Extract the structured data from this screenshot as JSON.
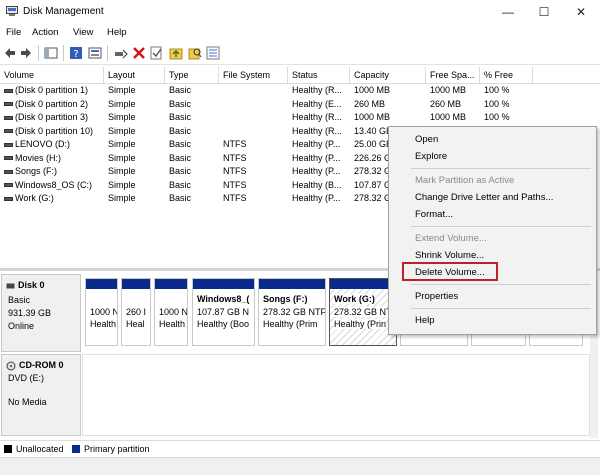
{
  "window": {
    "title": "Disk Management",
    "minimize_glyph": "—",
    "maximize_glyph": "☐",
    "close_glyph": "✕"
  },
  "menu": [
    "File",
    "Action",
    "View",
    "Help"
  ],
  "toolbar_icons": [
    "back-icon",
    "forward-icon",
    "console-tree-icon",
    "help-icon",
    "properties-icon",
    "connect-icon",
    "delete-icon",
    "check-icon",
    "folder-up-icon",
    "search-icon",
    "list-icon"
  ],
  "columns": [
    "Volume",
    "Layout",
    "Type",
    "File System",
    "Status",
    "Capacity",
    "Free Spa...",
    "% Free"
  ],
  "volumes": [
    {
      "volume": "(Disk 0 partition 1)",
      "layout": "Simple",
      "type": "Basic",
      "fs": "",
      "status": "Healthy (R...",
      "capacity": "1000 MB",
      "free": "1000 MB",
      "pct": "100 %"
    },
    {
      "volume": "(Disk 0 partition 2)",
      "layout": "Simple",
      "type": "Basic",
      "fs": "",
      "status": "Healthy (E...",
      "capacity": "260 MB",
      "free": "260 MB",
      "pct": "100 %"
    },
    {
      "volume": "(Disk 0 partition 3)",
      "layout": "Simple",
      "type": "Basic",
      "fs": "",
      "status": "Healthy (R...",
      "capacity": "1000 MB",
      "free": "1000 MB",
      "pct": "100 %"
    },
    {
      "volume": "(Disk 0 partition 10)",
      "layout": "Simple",
      "type": "Basic",
      "fs": "",
      "status": "Healthy (R...",
      "capacity": "13.40 GB",
      "free": "",
      "pct": ""
    },
    {
      "volume": "LENOVO (D:)",
      "layout": "Simple",
      "type": "Basic",
      "fs": "NTFS",
      "status": "Healthy (P...",
      "capacity": "25.00 GB",
      "free": "",
      "pct": ""
    },
    {
      "volume": "Movies (H:)",
      "layout": "Simple",
      "type": "Basic",
      "fs": "NTFS",
      "status": "Healthy (P...",
      "capacity": "226.26 G",
      "free": "",
      "pct": ""
    },
    {
      "volume": "Songs (F:)",
      "layout": "Simple",
      "type": "Basic",
      "fs": "NTFS",
      "status": "Healthy (P...",
      "capacity": "278.32 G",
      "free": "",
      "pct": ""
    },
    {
      "volume": "Windows8_OS (C:)",
      "layout": "Simple",
      "type": "Basic",
      "fs": "NTFS",
      "status": "Healthy (B...",
      "capacity": "107.87 G",
      "free": "",
      "pct": ""
    },
    {
      "volume": "Work (G:)",
      "layout": "Simple",
      "type": "Basic",
      "fs": "NTFS",
      "status": "Healthy (P...",
      "capacity": "278.32 G",
      "free": "",
      "pct": ""
    }
  ],
  "disk0": {
    "name": "Disk 0",
    "type": "Basic",
    "size": "931.39 GB",
    "state": "Online",
    "partitions": [
      {
        "name": "",
        "line1": "1000 N",
        "line2": "Health"
      },
      {
        "name": "",
        "line1": "260 I",
        "line2": "Heal"
      },
      {
        "name": "",
        "line1": "1000 N",
        "line2": "Health"
      },
      {
        "name": "Windows8_(",
        "line1": "107.87 GB N",
        "line2": "Healthy (Boo"
      },
      {
        "name": "Songs  (F:)",
        "line1": "278.32 GB NTF",
        "line2": "Healthy (Prim"
      },
      {
        "name": "Work  (G:)",
        "line1": "278.32 GB NTF",
        "line2": "Healthy (Prin"
      },
      {
        "name": "",
        "line1": "",
        "line2": ""
      },
      {
        "name": "",
        "line1": "",
        "line2": ""
      },
      {
        "name": "",
        "line1": "",
        "line2": ""
      }
    ]
  },
  "cdrom": {
    "name": "CD-ROM 0",
    "type": "DVD (E:)",
    "state": "No Media"
  },
  "legend": {
    "unallocated": "Unallocated",
    "primary": "Primary partition",
    "unallocated_color": "#000000",
    "primary_color": "#0a2a8c"
  },
  "context_menu": {
    "items": [
      {
        "label": "Open",
        "enabled": true
      },
      {
        "label": "Explore",
        "enabled": true
      },
      {
        "label": "Mark Partition as Active",
        "enabled": false
      },
      {
        "label": "Change Drive Letter and Paths...",
        "enabled": true
      },
      {
        "label": "Format...",
        "enabled": true
      },
      {
        "label": "Extend Volume...",
        "enabled": false
      },
      {
        "label": "Shrink Volume...",
        "enabled": true
      },
      {
        "label": "Delete Volume...",
        "enabled": true
      },
      {
        "label": "Properties",
        "enabled": true
      },
      {
        "label": "Help",
        "enabled": true
      }
    ],
    "highlight_color": "#c0202a"
  }
}
